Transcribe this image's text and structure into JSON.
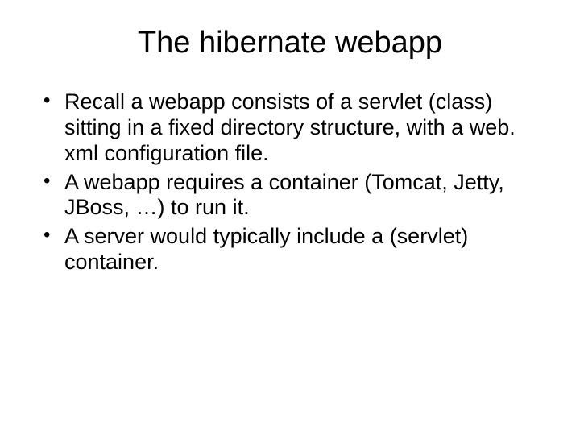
{
  "slide": {
    "title": "The hibernate webapp",
    "bullets": [
      "Recall a webapp consists of a servlet (class) sitting in a fixed directory structure, with a web. xml configuration file.",
      "A webapp requires a container (Tomcat, Jetty, JBoss, …) to run it.",
      "A server would typically include a (servlet) container."
    ]
  }
}
